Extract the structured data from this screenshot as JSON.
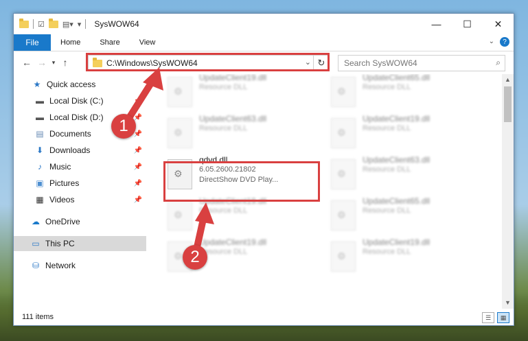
{
  "window": {
    "title": "SysWOW64"
  },
  "ribbon": {
    "file": "File",
    "tabs": [
      "Home",
      "Share",
      "View"
    ],
    "help": "?"
  },
  "nav": {
    "back_icon": "arrow-left",
    "forward_icon": "arrow-right",
    "up_icon": "arrow-up",
    "address": "C:\\Windows\\SysWOW64",
    "search_placeholder": "Search SysWOW64"
  },
  "sidebar": {
    "items": [
      {
        "label": "Quick access",
        "icon": "star",
        "pinned": false
      },
      {
        "label": "Local Disk (C:)",
        "icon": "disk",
        "pinned": true
      },
      {
        "label": "Local Disk (D:)",
        "icon": "disk",
        "pinned": true
      },
      {
        "label": "Documents",
        "icon": "documents",
        "pinned": true
      },
      {
        "label": "Downloads",
        "icon": "download",
        "pinned": true
      },
      {
        "label": "Music",
        "icon": "music",
        "pinned": true
      },
      {
        "label": "Pictures",
        "icon": "pictures",
        "pinned": true
      },
      {
        "label": "Videos",
        "icon": "videos",
        "pinned": true
      },
      {
        "label": "OneDrive",
        "icon": "cloud",
        "pinned": false
      },
      {
        "label": "This PC",
        "icon": "computer",
        "pinned": false,
        "selected": true
      },
      {
        "label": "Network",
        "icon": "network",
        "pinned": false
      }
    ]
  },
  "files": {
    "focus": {
      "name": "qdvd.dll",
      "version": "6.05.2600.21802",
      "description": "DirectShow DVD Play..."
    },
    "background": [
      {
        "name": "UpdateClient19.dll",
        "type": "Resource DLL"
      },
      {
        "name": "UpdateClient65.dll",
        "type": "Resource DLL"
      },
      {
        "name": "UpdateClient63.dll",
        "type": "Resource DLL"
      },
      {
        "name": "UpdateClient19.dll",
        "type": "Resource DLL"
      },
      {
        "name": "UpdateClient63.dll",
        "type": "Resource DLL"
      },
      {
        "name": "UpdateClient19.dll",
        "type": "Resource DLL"
      },
      {
        "name": "UpdateClient65.dll",
        "type": "Resource DLL"
      },
      {
        "name": "UpdateClient19.dll",
        "type": "Resource DLL"
      },
      {
        "name": "UpdateClient19.dll",
        "type": "Resource DLL"
      }
    ]
  },
  "status": {
    "count": "111 items"
  },
  "annotations": {
    "step1": "1",
    "step2": "2",
    "color": "#d94040"
  }
}
